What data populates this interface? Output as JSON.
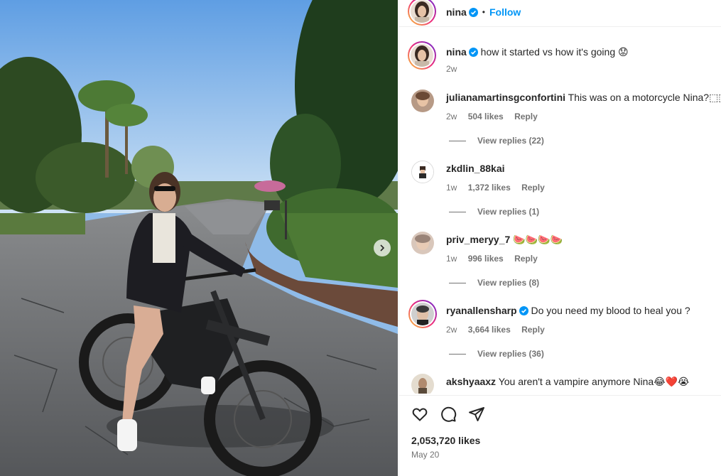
{
  "post": {
    "author": "nina",
    "follow_label": "Follow",
    "dot": "•"
  },
  "caption": {
    "username": "nina",
    "text": "how it started vs how it's going 😟",
    "time": "2w"
  },
  "comments": [
    {
      "username": "julianamartinsgconfortini",
      "text": "This was on a motorcycle Nina?⬚⬚",
      "time": "2w",
      "likes": "504 likes",
      "reply": "Reply",
      "view_replies": "View replies (22)"
    },
    {
      "username": "zkdlin_88kai",
      "text": "",
      "time": "1w",
      "likes": "1,372 likes",
      "reply": "Reply",
      "view_replies": "View replies (1)"
    },
    {
      "username": "priv_meryy_7",
      "text": "🍉🍉🍉🍉",
      "time": "1w",
      "likes": "996 likes",
      "reply": "Reply",
      "view_replies": "View replies (8)"
    },
    {
      "username": "ryanallensharp",
      "text": "Do you need my blood to heal you ?",
      "time": "2w",
      "likes": "3,664 likes",
      "reply": "Reply",
      "view_replies": "View replies (36)"
    },
    {
      "username": "akshyaaxz",
      "text": "You aren't a vampire anymore Nina😂❤️😭"
    }
  ],
  "footer": {
    "likes": "2,053,720 likes",
    "date": "May 20"
  },
  "colors": {
    "accent": "#0095f6",
    "verified": "#0095f6",
    "muted": "#737373"
  },
  "icons": [
    "chevron-right-icon",
    "verified-icon",
    "heart-icon",
    "comment-icon",
    "share-icon"
  ]
}
